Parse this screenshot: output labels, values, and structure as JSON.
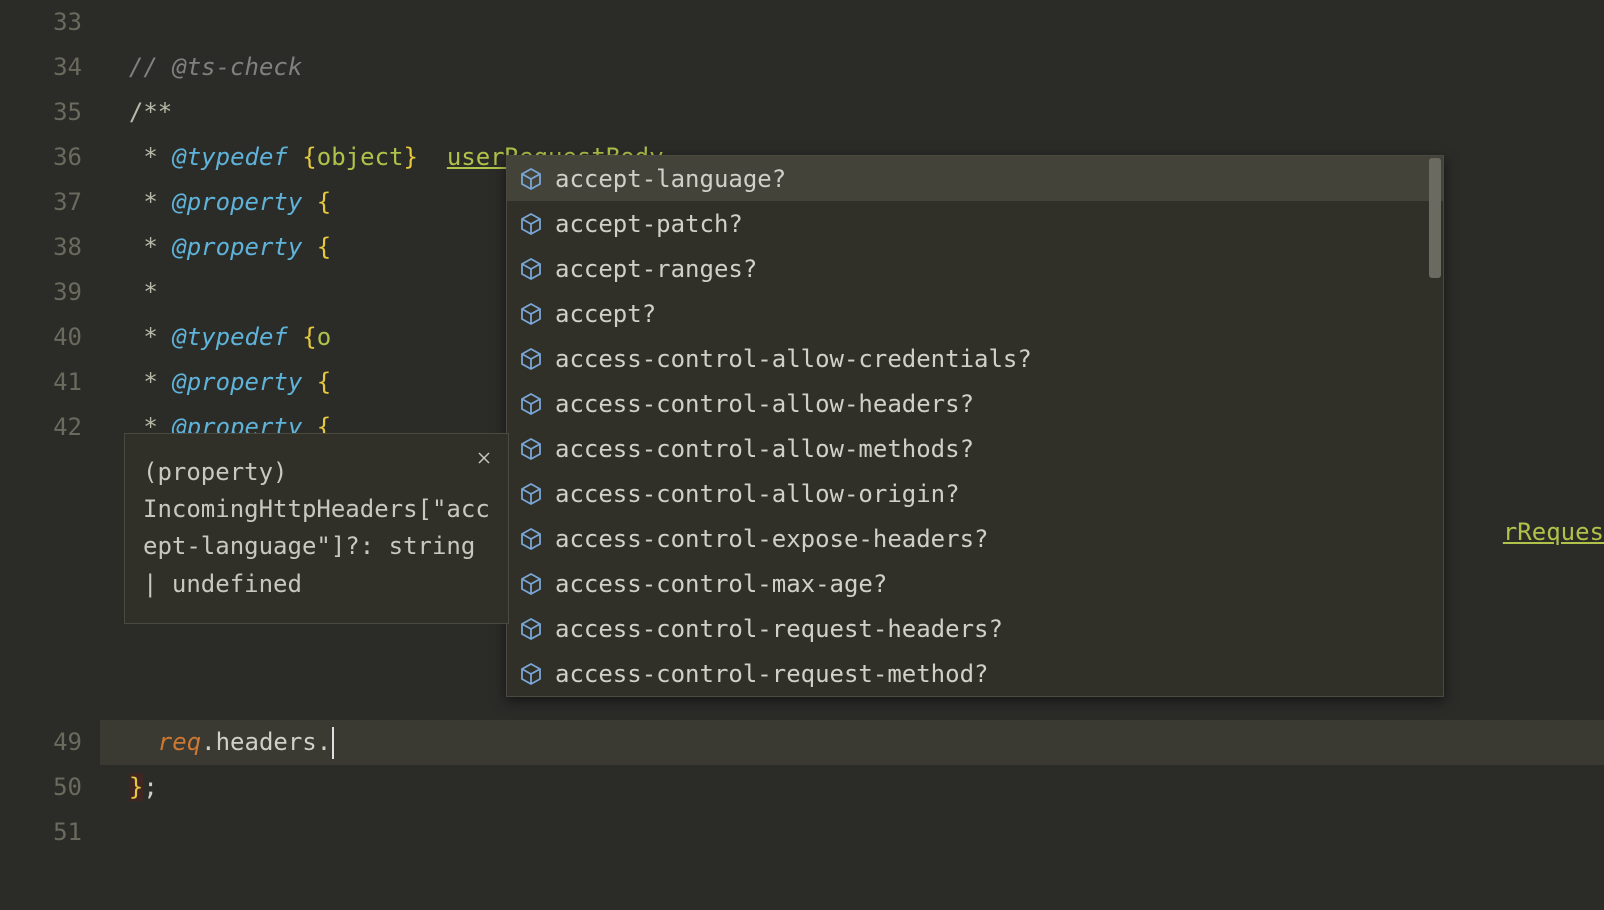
{
  "gutter": [
    "33",
    "34",
    "35",
    "36",
    "37",
    "38",
    "39",
    "40",
    "41",
    "42",
    "",
    "",
    "",
    "",
    "",
    "",
    "49",
    "50",
    "51"
  ],
  "code": {
    "line34_comment": "// @ts-check",
    "line35": "/**",
    "line36": {
      "star": " * ",
      "tag": "@typedef",
      "brace_open": " {",
      "type": "object",
      "brace_close": "}",
      "space": "  ",
      "name": "userRequestBody"
    },
    "line37": {
      "star": " * ",
      "tag": "@property",
      "brace_open": " {"
    },
    "line38": {
      "star": " * ",
      "tag": "@property",
      "brace_open": " {"
    },
    "line39": " *",
    "line40": {
      "star": " * ",
      "tag": "@typedef",
      "brace_open": " {",
      "type_partial": "o"
    },
    "line41": {
      "star": " * ",
      "tag": "@property",
      "brace_open": " {"
    },
    "line42": {
      "star": " * ",
      "tag": "@property",
      "brace_open": " {"
    },
    "line49": {
      "var": "req",
      "dot1": ".",
      "prop": "headers",
      "dot2": "."
    },
    "line50": "};",
    "right_peek": "rReques"
  },
  "autocomplete": {
    "items": [
      "accept-language?",
      "accept-patch?",
      "accept-ranges?",
      "accept?",
      "access-control-allow-credentials?",
      "access-control-allow-headers?",
      "access-control-allow-methods?",
      "access-control-allow-origin?",
      "access-control-expose-headers?",
      "access-control-max-age?",
      "access-control-request-headers?",
      "access-control-request-method?"
    ],
    "selected_index": 0
  },
  "tooltip": {
    "text": "(property) IncomingHttpHeaders[\"accept-language\"]?: string | undefined"
  }
}
